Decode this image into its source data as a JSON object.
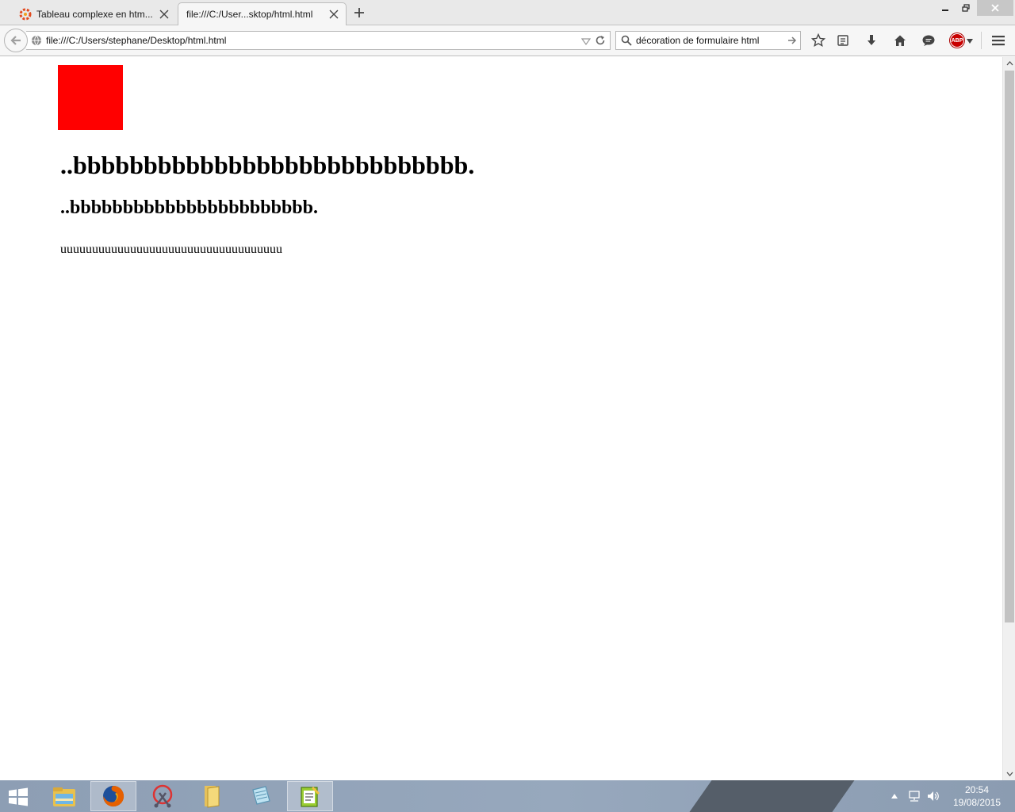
{
  "tabs": [
    {
      "title": "Tableau complexe en htm...",
      "icon": "colorful-ring-favicon",
      "active": false
    },
    {
      "title": "file:///C:/User...sktop/html.html",
      "icon": "none",
      "active": true
    }
  ],
  "urlbar": {
    "value": "file:///C:/Users/stephane/Desktop/html.html"
  },
  "searchbar": {
    "value": "décoration de formulaire html"
  },
  "toolbar_icons": [
    "star-icon",
    "reading-list-icon",
    "download-icon",
    "home-icon",
    "chat-icon",
    "adblock-icon",
    "menu-icon"
  ],
  "adblock": {
    "label": "ABP"
  },
  "page": {
    "box_color": "#ff0000",
    "heading1": "..bbbbbbbbbbbbbbbbbbbbbbbbbbbb.",
    "heading2": "..bbbbbbbbbbbbbbbbbbbbbbb.",
    "paragraph": "uuuuuuuuuuuuuuuuuuuuuuuuuuuuuuuuuuu"
  },
  "taskbar": {
    "apps": [
      "file-manager-icon",
      "firefox-icon",
      "snipping-tool-icon",
      "folder-icon",
      "notepad-icon",
      "editor-icon"
    ],
    "active_app": "firefox-icon",
    "time": "20:54",
    "date": "19/08/2015"
  }
}
